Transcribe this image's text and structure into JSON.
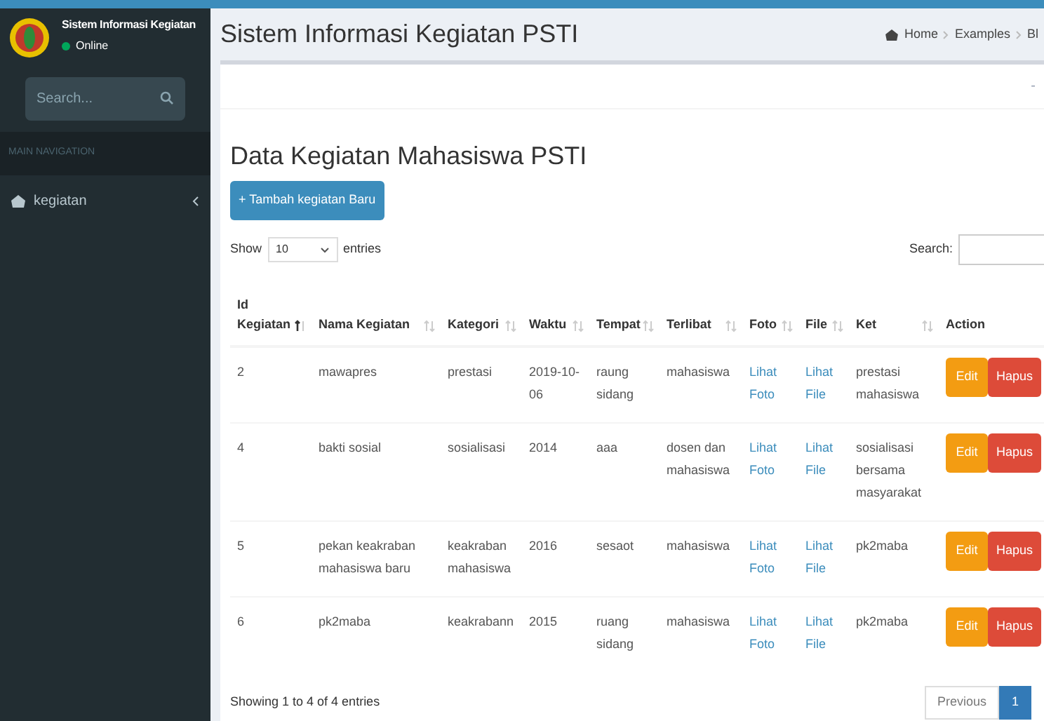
{
  "sidebar": {
    "app_name": "Sistem Informasi Kegiatan",
    "status": "Online",
    "search": {
      "placeholder": "Search..."
    },
    "section_header": "MAIN NAVIGATION",
    "items": [
      {
        "label": "kegiatan",
        "expanded": false
      }
    ]
  },
  "header": {
    "title": "Sistem Informasi Kegiatan PSTI",
    "breadcrumb": [
      "Home",
      "Examples",
      "Bl"
    ]
  },
  "box": {
    "collapse_symbol": "-",
    "heading": "Data Kegiatan Mahasiswa PSTI",
    "add_button": "+ Tambah kegiatan Baru",
    "length": {
      "before": "Show",
      "value": "10",
      "after": "entries"
    },
    "search_label": "Search:",
    "table": {
      "columns": [
        {
          "label": "Id Kegiatan",
          "sortable": true,
          "sorted": true
        },
        {
          "label": "Nama Kegiatan",
          "sortable": true,
          "sorted": false
        },
        {
          "label": "Kategori",
          "sortable": true,
          "sorted": false
        },
        {
          "label": "Waktu",
          "sortable": true,
          "sorted": false
        },
        {
          "label": "Tempat",
          "sortable": true,
          "sorted": false
        },
        {
          "label": "Terlibat",
          "sortable": true,
          "sorted": false
        },
        {
          "label": "Foto",
          "sortable": true,
          "sorted": false
        },
        {
          "label": "File",
          "sortable": true,
          "sorted": false
        },
        {
          "label": "Ket",
          "sortable": true,
          "sorted": false
        },
        {
          "label": "Action",
          "sortable": false
        }
      ],
      "rows": [
        {
          "cells": [
            "2",
            "mawapres",
            "prestasi",
            "2019-10-06",
            "raung sidang",
            "mahasiswa",
            "Lihat Foto",
            "Lihat File",
            "prestasi mahasiswa"
          ],
          "actions": [
            "Edit",
            "Hapus"
          ]
        },
        {
          "cells": [
            "4",
            "bakti sosial",
            "sosialisasi",
            "2014",
            "aaa",
            "dosen dan mahasiswa",
            "Lihat Foto",
            "Lihat File",
            "sosialisasi bersama masyarakat"
          ],
          "actions": [
            "Edit",
            "Hapus"
          ]
        },
        {
          "cells": [
            "5",
            "pekan keakraban mahasiswa baru",
            "keakraban mahasiswa",
            "2016",
            "sesaot",
            "mahasiswa",
            "Lihat Foto",
            "Lihat File",
            "pk2maba"
          ],
          "actions": [
            "Edit",
            "Hapus"
          ]
        },
        {
          "cells": [
            "6",
            "pk2maba",
            "keakrabann",
            "2015",
            "ruang sidang",
            "mahasiswa",
            "Lihat Foto",
            "Lihat File",
            "pk2maba"
          ],
          "actions": [
            "Edit",
            "Hapus"
          ]
        }
      ]
    },
    "info": "Showing 1 to 4 of 4 entries",
    "pagination": [
      {
        "label": "Previous",
        "selected": false
      },
      {
        "label": "1",
        "selected": true
      }
    ]
  }
}
